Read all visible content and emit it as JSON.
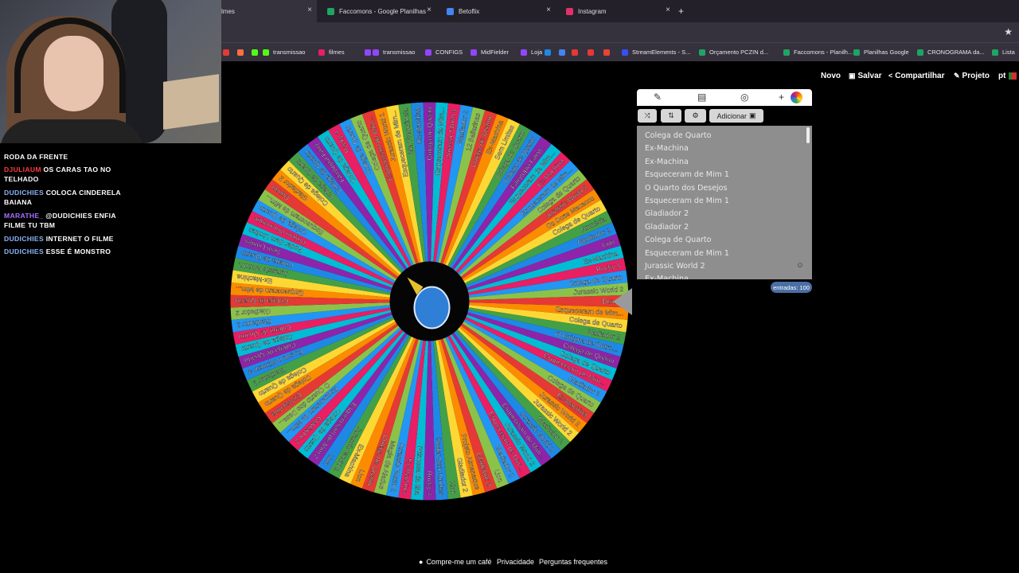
{
  "browser": {
    "tabs": [
      {
        "label": "lmes",
        "active": true,
        "color": "#cc3b2b"
      },
      {
        "label": "Faccomons - Google Planilhas",
        "active": false,
        "color": "#1fa463"
      },
      {
        "label": "Betoflix",
        "active": false,
        "color": "#4285f4"
      },
      {
        "label": "Instagram",
        "active": false,
        "color": "#e1306c"
      }
    ],
    "new_tab_icon": "+",
    "close_icon": "×",
    "bookmarks": [
      {
        "label": "",
        "color": "#e53935"
      },
      {
        "label": "",
        "color": "#ff7043"
      },
      {
        "label": "",
        "color": "#53fc18"
      },
      {
        "label": "transmissao",
        "color": "#53fc18"
      },
      {
        "label": "filmes",
        "color": "#e91e63"
      },
      {
        "label": "",
        "color": "#9146ff"
      },
      {
        "label": "transmissao",
        "color": "#9146ff"
      },
      {
        "label": "CONFIGS",
        "color": "#9146ff"
      },
      {
        "label": "MidFielder",
        "color": "#9146ff"
      },
      {
        "label": "Loja",
        "color": "#9146ff"
      },
      {
        "label": "",
        "color": "#1e88e5"
      },
      {
        "label": "",
        "color": "#4285f4"
      },
      {
        "label": "",
        "color": "#e53935"
      },
      {
        "label": "",
        "color": "#e53935"
      },
      {
        "label": "",
        "color": "#ea4335"
      },
      {
        "label": "StreamElements - S...",
        "color": "#3a4ff0"
      },
      {
        "label": "Orçamento PCZIN d...",
        "color": "#1fa463"
      },
      {
        "label": "Faccomons - Planilh...",
        "color": "#1fa463"
      },
      {
        "label": "Planilhas Google",
        "color": "#1fa463"
      },
      {
        "label": "CRONOGRAMA da...",
        "color": "#1fa463"
      },
      {
        "label": "Lista",
        "color": "#1fa463"
      }
    ]
  },
  "chat": {
    "messages": [
      {
        "user": "",
        "text": "RODA DA FRENTE",
        "user_color": "#8ab4f8"
      },
      {
        "user": "DJULIAUM",
        "text": "OS CARAS TAO NO TELHADO",
        "user_color": "#ff3b3b"
      },
      {
        "user": "DUDICHIES",
        "text": "COLOCA CINDERELA BAIANA",
        "user_color": "#8ab4f8"
      },
      {
        "user": "MARATHE_",
        "text": "@DUDICHIES ENFIA FILME TU TBM",
        "user_color": "#a970ff"
      },
      {
        "user": "DUDICHIES",
        "text": "INTERNET O FILME",
        "user_color": "#8ab4f8"
      },
      {
        "user": "DUDICHIES",
        "text": "ESSE É MONSTRO",
        "user_color": "#8ab4f8"
      }
    ]
  },
  "site": {
    "nav": {
      "new": "Novo",
      "save": "Salvar",
      "share": "Compartilhar",
      "project": "Projeto",
      "lang": "pt"
    },
    "panel": {
      "add_button": "Adicionar",
      "entries": [
        "Colega de Quarto",
        "Ex-Machina",
        "Ex-Machina",
        "Esqueceram de Mim 1",
        "O Quarto dos Desejos",
        "Esqueceram de Mim 1",
        "Gladiador 2",
        "Gladiador 2",
        "Colega de Quarto",
        "Esqueceram de Mim 1",
        "Jurassic World 2",
        "Ex-Machina"
      ],
      "count_label": "entradas: 100"
    },
    "footer": {
      "coffee": "Compre-me um café",
      "privacy": "Privacidade",
      "faq": "Perguntas frequentes"
    }
  },
  "wheel": {
    "segment_count": 100,
    "colors": [
      "#e53935",
      "#fb8c00",
      "#fdd835",
      "#43a047",
      "#1e88e5",
      "#8e24aa",
      "#00bcd4",
      "#e91e63",
      "#2196f3",
      "#8bc34a"
    ],
    "labels": [
      "Duna 2",
      "Esqueceram de Mim...",
      "Colega de Quarto",
      "Gladiador 2",
      "O Enigma de Outro...",
      "Colega de Quarto",
      "Colega de Quarto",
      "Esqueceram de Mim...",
      "Gladiador 2",
      "Colega de Quarto",
      "Ex-Machina",
      "Jurassic World 2",
      "Jurassic World 2",
      "Gladiador 2",
      "Jurassic World 1",
      "Esqueceram de Mim...",
      "Jurassic World 2",
      "Esqueceram de Mim...",
      "Gladiador 2",
      "Lion",
      "Gladiador 2",
      "Projeto Almanaque",
      "Gladiador 2",
      "Lion",
      "Poder Sem Limites",
      "Rocky 4",
      "Princesa da Ilha",
      "Ex-Machina",
      "Jurassic World 2",
      "Magia de Aladus",
      "Colega de Quarto",
      "Lion",
      "Ex-Machina",
      "Jurassic World 2",
      "Lion",
      "Esqueceram de Mim 2",
      "Colega de Quarto",
      "Gladiador 2",
      "Esqueceram de Mim...",
      "O Quarto dos Dese...",
      "Ex-Machina",
      "Colega de Quarto",
      "Colega de Quarto",
      "Gladiador 2",
      "Eu sou o Número 4",
      "Colega de Quarto",
      "Colega de Quarto",
      "Colega de Quarto",
      "Gladiador 2",
      "Gladiador 2",
      "Colega de Quarto",
      "Esqueceram de Mim...",
      "Ex-Machina",
      "Jurassic World 1",
      "Colega de Quarto",
      "Sem Limites",
      "Poder Sem Limites",
      "Projeto Almanaque",
      "Colega de Quarto",
      "Esqueceram de Mim...",
      "Dunno",
      "Gladiador 2",
      "Colega de Quarto",
      "Colega de Quarto",
      "Colega de Quarto",
      "Fairytopia Fairy",
      "Colega de Quarto",
      "Rocky 4",
      "Colega de Quarto",
      "Colega de Quarto",
      "Esqueceram de Mim...",
      "Jurassic World 1",
      "Esqueceram de Mim...",
      "Alta Frequência",
      "Ex-Machina",
      "Colega de Quarto",
      "Esqueceram de Mim...",
      "Jurassic World 1",
      "Gladiador 2",
      "12 Bailarinas",
      "Colega de Quarto",
      "Ex-Machina",
      "Sem Limites",
      "Colega de Quarto",
      "Colega de Quarto",
      "Fairytopia Fairyt...",
      "Esqueceram de Mim...",
      "Ex-Machina",
      "Esqueceram de Mim...",
      "Colega de Quarto",
      "Jurassic World 2",
      "Os Doze Macacos",
      "Colega de Quarto",
      "Amnésia",
      "Gladiador 2",
      "Lion",
      "Ex-Machina",
      "Rocky 4",
      "Colega de Quarto",
      "Jurassic World 2"
    ]
  }
}
